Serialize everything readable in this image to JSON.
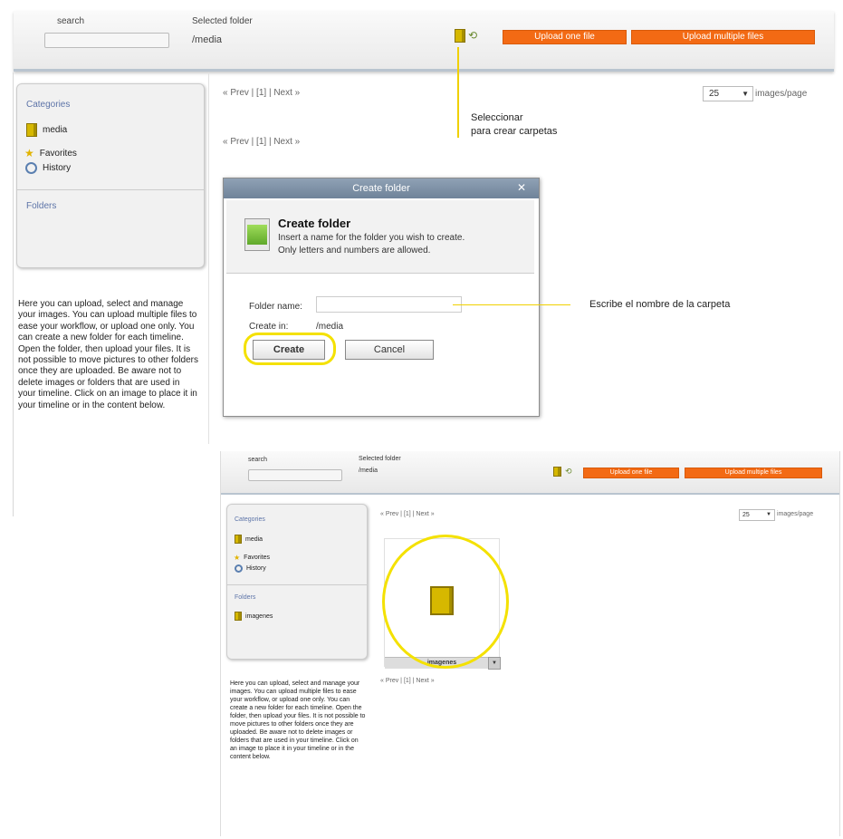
{
  "header": {
    "search_label": "search",
    "selected_folder_label": "Selected folder",
    "selected_folder_value": "/media",
    "upload_one": "Upload one file",
    "upload_multiple": "Upload multiple files"
  },
  "sidebar": {
    "categories_title": "Categories",
    "items": [
      {
        "label": "media",
        "icon": "folder-icon"
      },
      {
        "label": "Favorites",
        "icon": "star-icon"
      },
      {
        "label": "History",
        "icon": "history-icon"
      }
    ],
    "folders_title": "Folders"
  },
  "pager": {
    "text": "« Prev | [1] | Next »"
  },
  "per_page": {
    "value": "25",
    "label": "images/page"
  },
  "help_text": "Here you can upload, select and manage your images. You can upload multiple files to ease your workflow, or upload one only. You can create a new folder for each timeline. Open the folder, then upload your files. It is not possible to move pictures to other folders once they are uploaded. Be aware not to delete images or folders that are used in your timeline. Click on an image to place it in your timeline or in the content below.",
  "dialog": {
    "title": "Create folder",
    "close": "✕",
    "heading": "Create folder",
    "desc1": "Insert a name for the folder you wish to create.",
    "desc2": "Only letters and numbers are allowed.",
    "folder_name_label": "Folder name:",
    "folder_name_value": "",
    "create_in_label": "Create in:",
    "create_in_value": "/media",
    "create_button": "Create",
    "cancel_button": "Cancel"
  },
  "annotations": {
    "select_line1": "Seleccionar",
    "select_line2": "para crear carpetas",
    "write_name": "Escribe el nombre de la carpeta"
  },
  "second": {
    "search_label": "search",
    "selected_folder_label": "Selected folder",
    "selected_folder_value": "/media",
    "upload_one": "Upload one file",
    "upload_multiple": "Upload multiple files",
    "categories_title": "Categories",
    "items": [
      "media",
      "Favorites",
      "History"
    ],
    "folders_title": "Folders",
    "folder_item": "imagenes",
    "thumb_label": "imagenes",
    "pager": "« Prev | [1] | Next »",
    "per_page_value": "25",
    "per_page_label": "images/page"
  },
  "colors": {
    "accent": "#f36a14",
    "highlight": "#f4e100",
    "title_blue": "#5d74a8"
  }
}
